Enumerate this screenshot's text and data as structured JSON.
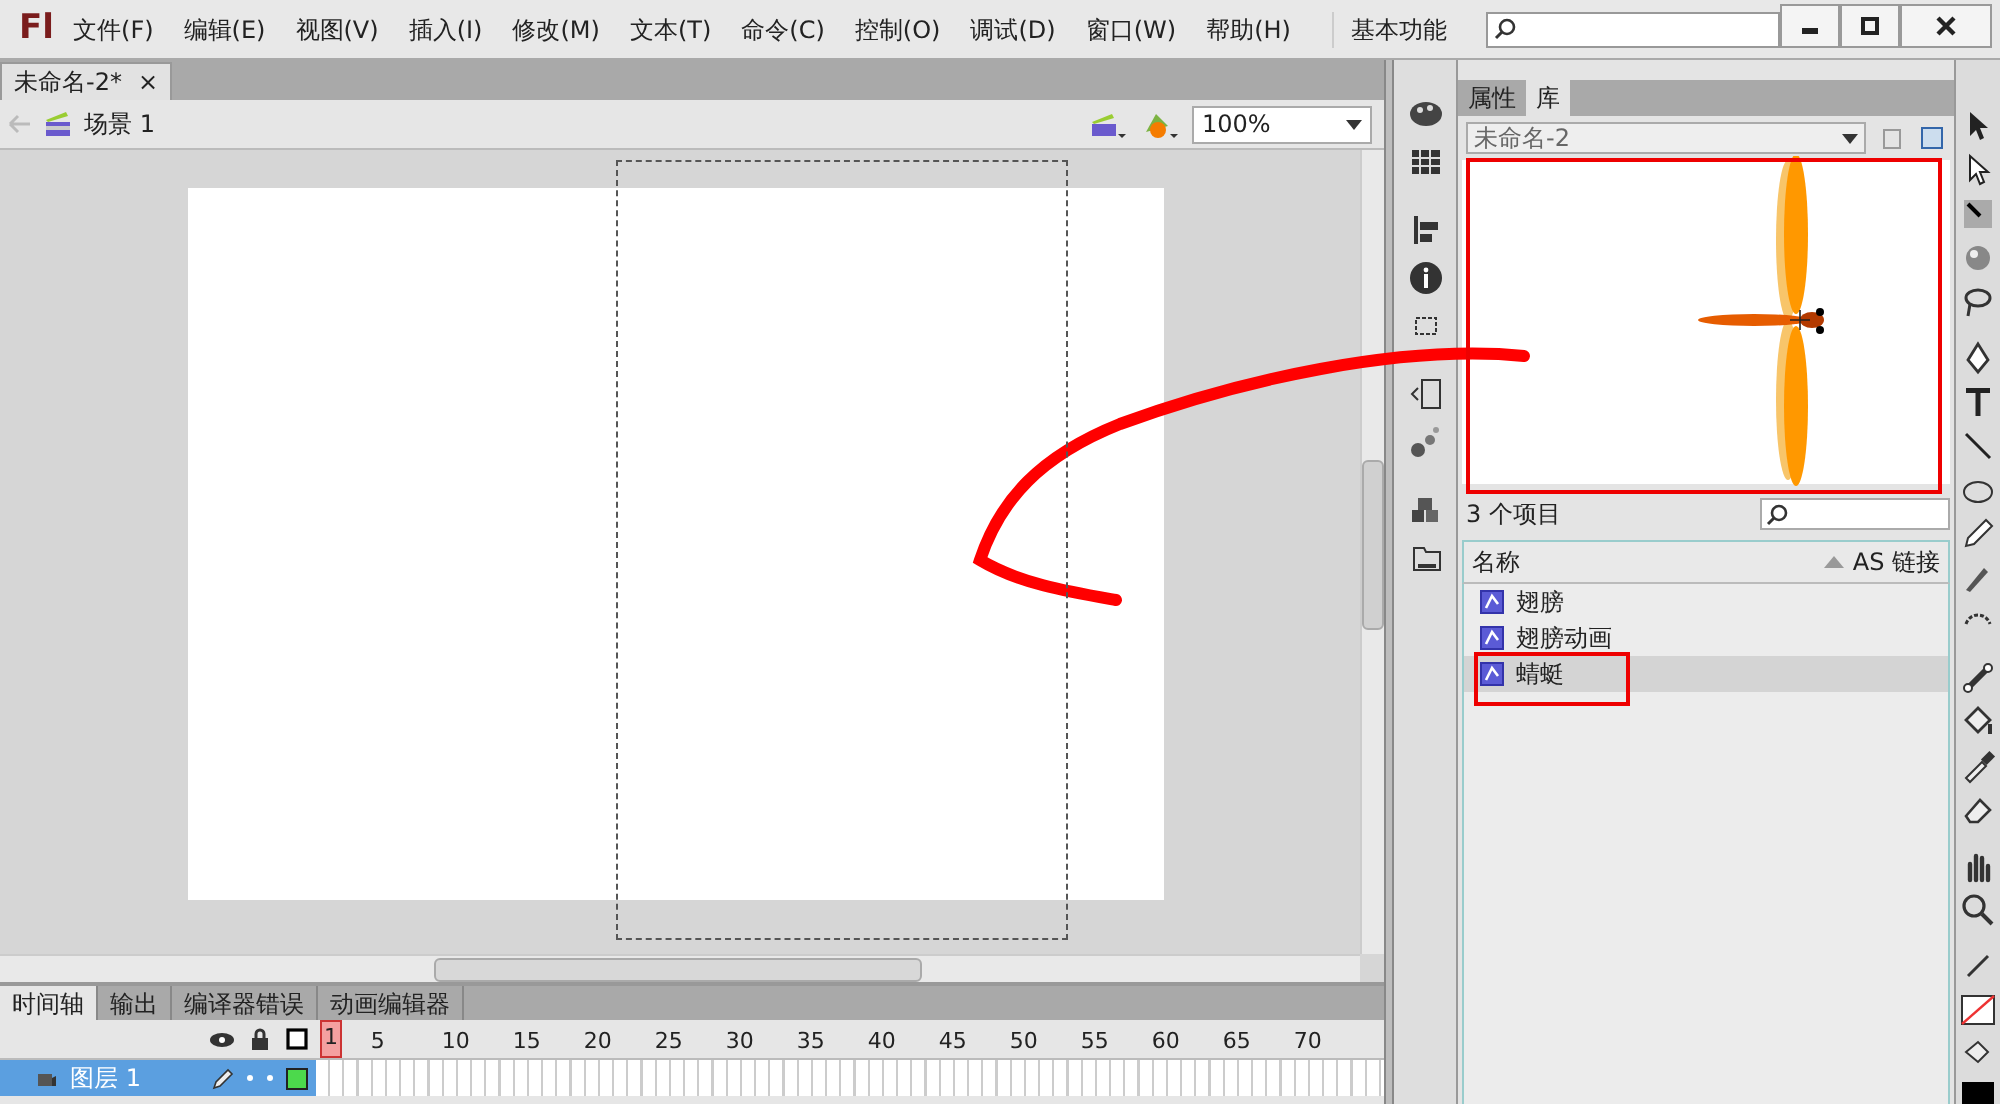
{
  "app": {
    "logo": "Fl",
    "menu": [
      "文件(F)",
      "编辑(E)",
      "视图(V)",
      "插入(I)",
      "修改(M)",
      "文本(T)",
      "命令(C)",
      "控制(O)",
      "调试(D)",
      "窗口(W)",
      "帮助(H)"
    ],
    "workspace": "基本功能"
  },
  "document_tabs": [
    {
      "label": "未命名-2*",
      "close": "×",
      "selected": true
    }
  ],
  "breadcrumb": "场景 1",
  "zoom": "100%",
  "timeline": {
    "tabs": [
      {
        "label": "时间轴",
        "selected": true
      },
      {
        "label": "输出",
        "selected": false
      },
      {
        "label": "编译器错误",
        "selected": false
      },
      {
        "label": "动画编辑器",
        "selected": false
      }
    ],
    "frame_numbers": [
      "1",
      "5",
      "10",
      "15",
      "20",
      "25",
      "30",
      "35",
      "40",
      "45",
      "50",
      "55",
      "60",
      "65",
      "70"
    ],
    "layers": [
      {
        "name": "图层 1",
        "selected": true
      }
    ]
  },
  "library": {
    "tabs": [
      {
        "label": "属性",
        "selected": false
      },
      {
        "label": "库",
        "selected": true
      }
    ],
    "document": "未命名-2",
    "count": "3 个项目",
    "columns": [
      "名称",
      "AS 链接"
    ],
    "items": [
      {
        "name": "翅膀",
        "selected": false
      },
      {
        "name": "翅膀动画",
        "selected": false
      },
      {
        "name": "蜻蜓",
        "selected": true
      }
    ]
  }
}
